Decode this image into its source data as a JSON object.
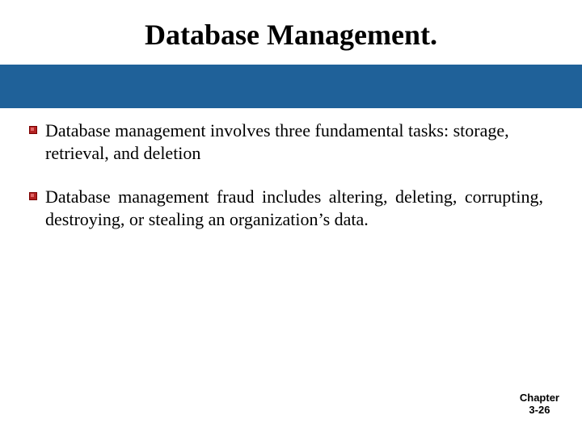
{
  "title": "Database Management.",
  "bar_color": "#1F6199",
  "bullets": [
    {
      "text": "Database management involves three fundamental tasks: storage, retrieval, and deletion",
      "justify": false
    },
    {
      "text": "Database management fraud includes altering, deleting, corrupting, destroying, or stealing an organization’s data.",
      "justify": true
    }
  ],
  "footer": {
    "line1": "Chapter",
    "line2": "3-26"
  },
  "bullet_svg": {
    "dark": "#7A0000",
    "mid": "#B22222",
    "light": "#E06666"
  }
}
